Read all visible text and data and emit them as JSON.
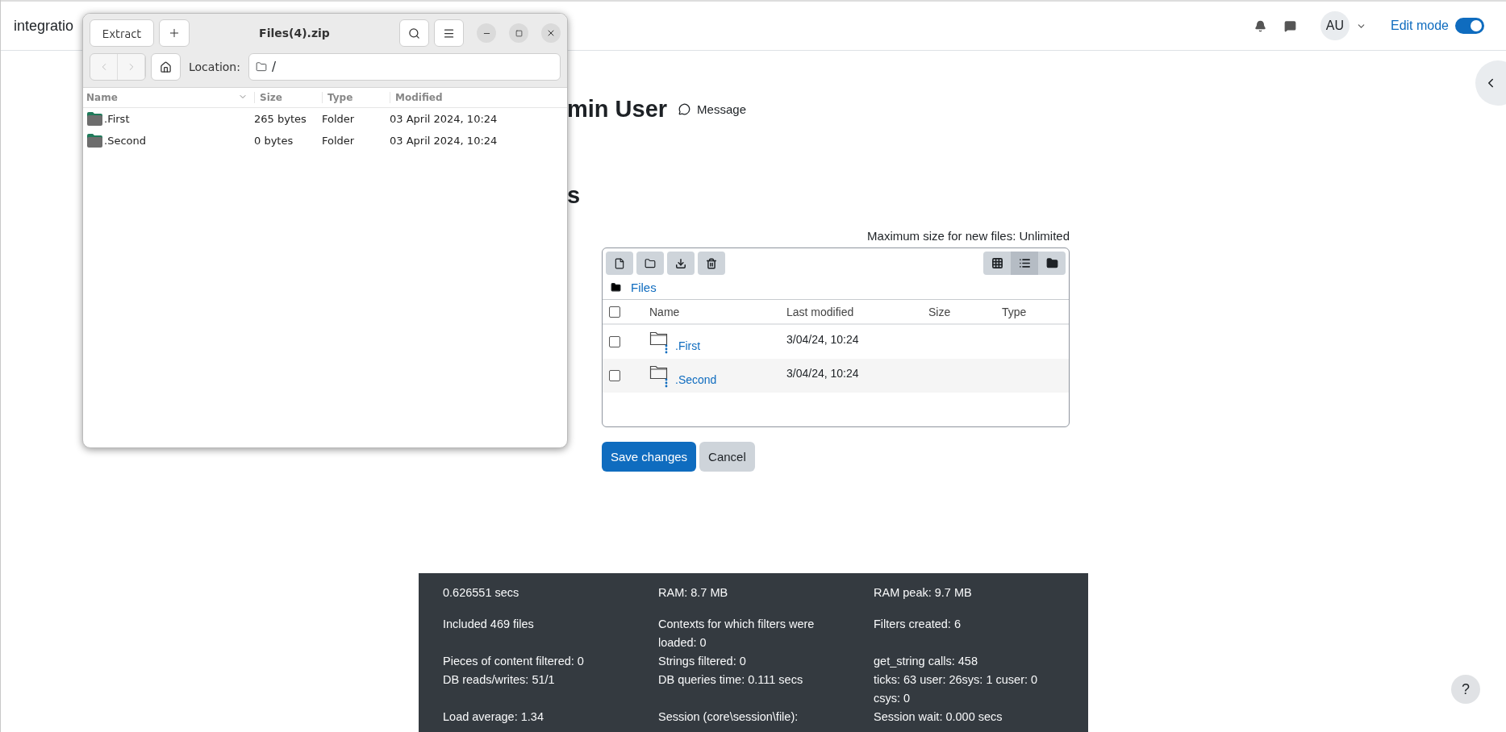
{
  "site": {
    "name": "integratio"
  },
  "navbar": {
    "avatar": "AU",
    "edit_mode": {
      "label": "Edit mode",
      "on": true
    }
  },
  "profile": {
    "name": "min User",
    "message": "Message"
  },
  "section_title": "s",
  "file_manager": {
    "max_size": "Maximum size for new files: Unlimited",
    "views": [
      {
        "kind": "icons",
        "selected": false
      },
      {
        "kind": "list",
        "selected": true
      },
      {
        "kind": "tree",
        "selected": false
      }
    ],
    "breadcrumb": "Files",
    "select_all": false,
    "columns": [
      "Name",
      "Last modified",
      "Size",
      "Type"
    ],
    "rows": [
      {
        "name": ".First",
        "modified": "3/04/24, 10:24",
        "checked": false
      },
      {
        "name": ".Second",
        "modified": "3/04/24, 10:24",
        "checked": false
      }
    ]
  },
  "buttons": {
    "save": "Save changes",
    "cancel": "Cancel"
  },
  "footer": {
    "rows": [
      [
        "0.626551 secs",
        "RAM: 8.7 MB",
        "RAM peak: 9.7 MB"
      ],
      [
        "Included 469 files",
        "Contexts for which filters were loaded: 0",
        "Filters created: 6"
      ],
      [
        "Pieces of content filtered: 0",
        "Strings filtered: 0",
        "get_string calls: 458"
      ],
      [
        "DB reads/writes: 51/1",
        "DB queries time: 0.111 secs",
        "ticks: 63 user: 26sys: 1 cuser: 0 csys: 0"
      ],
      [
        "Load average: 1.34",
        "Session (core\\session\\file):",
        "Session wait: 0.000 secs"
      ]
    ]
  },
  "help": "?",
  "archive_window": {
    "title": "Files(4).zip",
    "extract": "Extract",
    "location_label": "Location:",
    "location": "/",
    "columns": [
      "Name",
      "Size",
      "Type",
      "Modified"
    ],
    "rows": [
      {
        "name": ".First",
        "size": "265 bytes",
        "type": "Folder",
        "modified": "03 April 2024, 10:24"
      },
      {
        "name": ".Second",
        "size": "0 bytes",
        "type": "Folder",
        "modified": "03 April 2024, 10:24"
      }
    ]
  }
}
